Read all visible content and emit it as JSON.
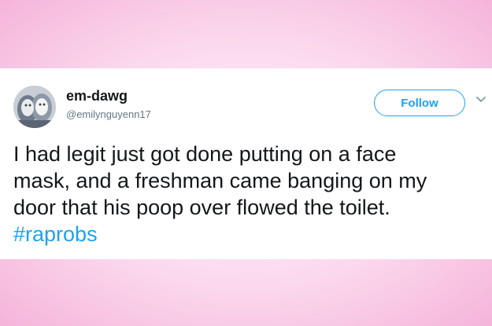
{
  "tweet": {
    "display_name": "em-dawg",
    "handle": "@emilynguyenn17",
    "follow_label": "Follow",
    "text_lines": [
      "I had legit just got done putting on a face",
      "mask, and a freshman came banging on my",
      "door that his poop over flowed the toilet."
    ],
    "hashtag": "#raprobs"
  },
  "colors": {
    "accent": "#1da1f2",
    "text": "#14171a",
    "muted": "#657786",
    "background_pink": "#f5b4da"
  },
  "icons": {
    "avatar": "profile-photo",
    "caret": "chevron-down-icon"
  }
}
